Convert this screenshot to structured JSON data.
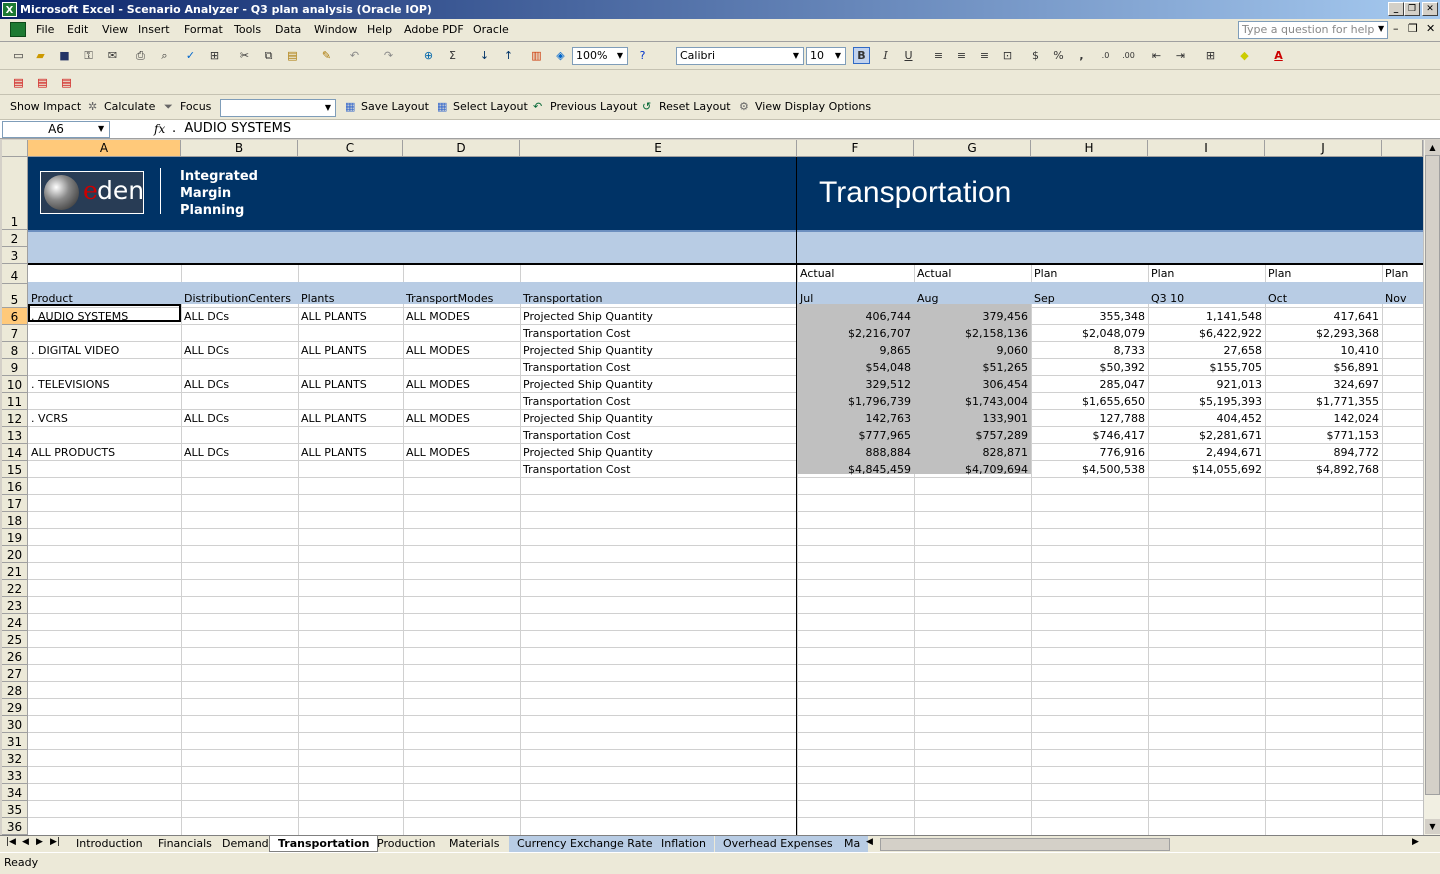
{
  "window": {
    "title": "Microsoft Excel - Scenario Analyzer - Q3 plan analysis (Oracle IOP)",
    "app_icon": "excel-icon"
  },
  "menu": {
    "items": [
      "File",
      "Edit",
      "View",
      "Insert",
      "Format",
      "Tools",
      "Data",
      "Window",
      "Help",
      "Adobe PDF",
      "Oracle"
    ],
    "help_placeholder": "Type a question for help"
  },
  "toolbar": {
    "zoom": "100%",
    "font": "Calibri",
    "font_size": "10",
    "bold": "B",
    "italic": "I",
    "underline": "U",
    "sigma": "Σ",
    "currency": "$",
    "percent": "%",
    "comma": ","
  },
  "oracle_toolbar": {
    "show_impact": "Show Impact",
    "calculate": "Calculate",
    "focus": "Focus",
    "save_layout": "Save Layout",
    "select_layout": "Select Layout",
    "previous_layout": "Previous Layout",
    "reset_layout": "Reset Layout",
    "view_display_options": "View Display Options"
  },
  "formula_bar": {
    "name_box": "A6",
    "fx": "fx",
    "value": ".  AUDIO SYSTEMS"
  },
  "banner": {
    "logo_text": "den",
    "logo_e": "e",
    "lines": [
      "Integrated",
      "Margin",
      "Planning"
    ],
    "title": "Transportation"
  },
  "columns": [
    "A",
    "B",
    "C",
    "D",
    "E",
    "F",
    "G",
    "H",
    "I",
    "J"
  ],
  "row_numbers": [
    "1",
    "2",
    "3",
    "4",
    "5",
    "6",
    "7",
    "8",
    "9",
    "10",
    "11",
    "12",
    "13",
    "14",
    "15",
    "16",
    "17",
    "18",
    "19",
    "20",
    "21",
    "22",
    "23",
    "24",
    "25",
    "26",
    "27",
    "28",
    "29",
    "30",
    "31",
    "32",
    "33",
    "34",
    "35",
    "36"
  ],
  "headers": {
    "row4": [
      "Actual",
      "Actual",
      "Plan",
      "Plan",
      "Plan",
      "Plan"
    ],
    "row5_left": [
      "Product",
      "DistributionCenters",
      "Plants",
      "TransportModes",
      "Transportation"
    ],
    "row5_periods": [
      "Jul",
      "Aug",
      "Sep",
      "Q3 10",
      "Oct",
      "Nov"
    ]
  },
  "rows": [
    {
      "product": ".  AUDIO SYSTEMS",
      "dc": "ALL DCs",
      "plant": "ALL PLANTS",
      "mode": "ALL MODES",
      "measure": "Projected Ship Quantity",
      "values": [
        "406,744",
        "379,456",
        "355,348",
        "1,141,548",
        "417,641"
      ]
    },
    {
      "product": "",
      "dc": "",
      "plant": "",
      "mode": "",
      "measure": "Transportation Cost",
      "values": [
        "$2,216,707",
        "$2,158,136",
        "$2,048,079",
        "$6,422,922",
        "$2,293,368"
      ]
    },
    {
      "product": ".  DIGITAL VIDEO",
      "dc": "ALL DCs",
      "plant": "ALL PLANTS",
      "mode": "ALL MODES",
      "measure": "Projected Ship Quantity",
      "values": [
        "9,865",
        "9,060",
        "8,733",
        "27,658",
        "10,410"
      ]
    },
    {
      "product": "",
      "dc": "",
      "plant": "",
      "mode": "",
      "measure": "Transportation Cost",
      "values": [
        "$54,048",
        "$51,265",
        "$50,392",
        "$155,705",
        "$56,891"
      ]
    },
    {
      "product": ".  TELEVISIONS",
      "dc": "ALL DCs",
      "plant": "ALL PLANTS",
      "mode": "ALL MODES",
      "measure": "Projected Ship Quantity",
      "values": [
        "329,512",
        "306,454",
        "285,047",
        "921,013",
        "324,697"
      ]
    },
    {
      "product": "",
      "dc": "",
      "plant": "",
      "mode": "",
      "measure": "Transportation Cost",
      "values": [
        "$1,796,739",
        "$1,743,004",
        "$1,655,650",
        "$5,195,393",
        "$1,771,355"
      ]
    },
    {
      "product": ".  VCRS",
      "dc": "ALL DCs",
      "plant": "ALL PLANTS",
      "mode": "ALL MODES",
      "measure": "Projected Ship Quantity",
      "values": [
        "142,763",
        "133,901",
        "127,788",
        "404,452",
        "142,024"
      ]
    },
    {
      "product": "",
      "dc": "",
      "plant": "",
      "mode": "",
      "measure": "Transportation Cost",
      "values": [
        "$777,965",
        "$757,289",
        "$746,417",
        "$2,281,671",
        "$771,153"
      ]
    },
    {
      "product": "ALL PRODUCTS",
      "dc": "ALL DCs",
      "plant": "ALL PLANTS",
      "mode": "ALL MODES",
      "measure": "Projected Ship Quantity",
      "values": [
        "888,884",
        "828,871",
        "776,916",
        "2,494,671",
        "894,772"
      ]
    },
    {
      "product": "",
      "dc": "",
      "plant": "",
      "mode": "",
      "measure": "Transportation Cost",
      "values": [
        "$4,845,459",
        "$4,709,694",
        "$4,500,538",
        "$14,055,692",
        "$4,892,768"
      ]
    }
  ],
  "sheet_tabs": [
    "Introduction",
    "Financials",
    "Demand",
    "Transportation",
    "Production",
    "Materials",
    "Currency Exchange Rate",
    "Inflation",
    "Overhead Expenses",
    "Ma"
  ],
  "active_tab": "Transportation",
  "status": "Ready",
  "colors": {
    "banner": "#003366",
    "band": "#b8cce4",
    "actual_fill": "#c0c0c0"
  }
}
